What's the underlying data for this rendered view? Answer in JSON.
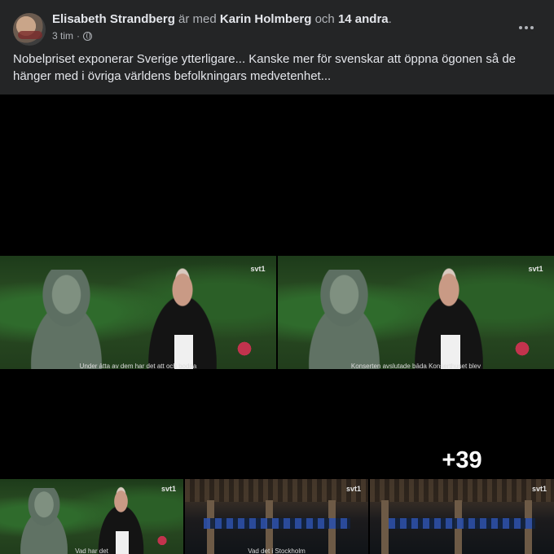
{
  "post": {
    "author": "Elisabeth Strandberg",
    "with_text": "är med",
    "tagged": "Karin Holmberg",
    "and_text": "och",
    "others": "14 andra",
    "period": ".",
    "time": "3 tim",
    "separator": "·",
    "privacy_icon": "globe-icon",
    "more_icon": "more-options-icon",
    "text": "Nobelpriset exponerar Sverige ytterligare... Kanske mer för svenskar att öppna ögonen så de hänger med i övriga världens befolkningars medvetenhet..."
  },
  "media": {
    "logo": "svt1",
    "subtitles": [
      "Under åtta av dem har det att och bodna",
      "Konserten avslutade båda Konserthuset blev",
      "Vad har det",
      "Vad det i Stockholm",
      ""
    ],
    "remaining_count": "+39"
  },
  "colors": {
    "card_bg": "#242526",
    "text_primary": "#e4e6eb",
    "text_secondary": "#b0b3b8"
  }
}
